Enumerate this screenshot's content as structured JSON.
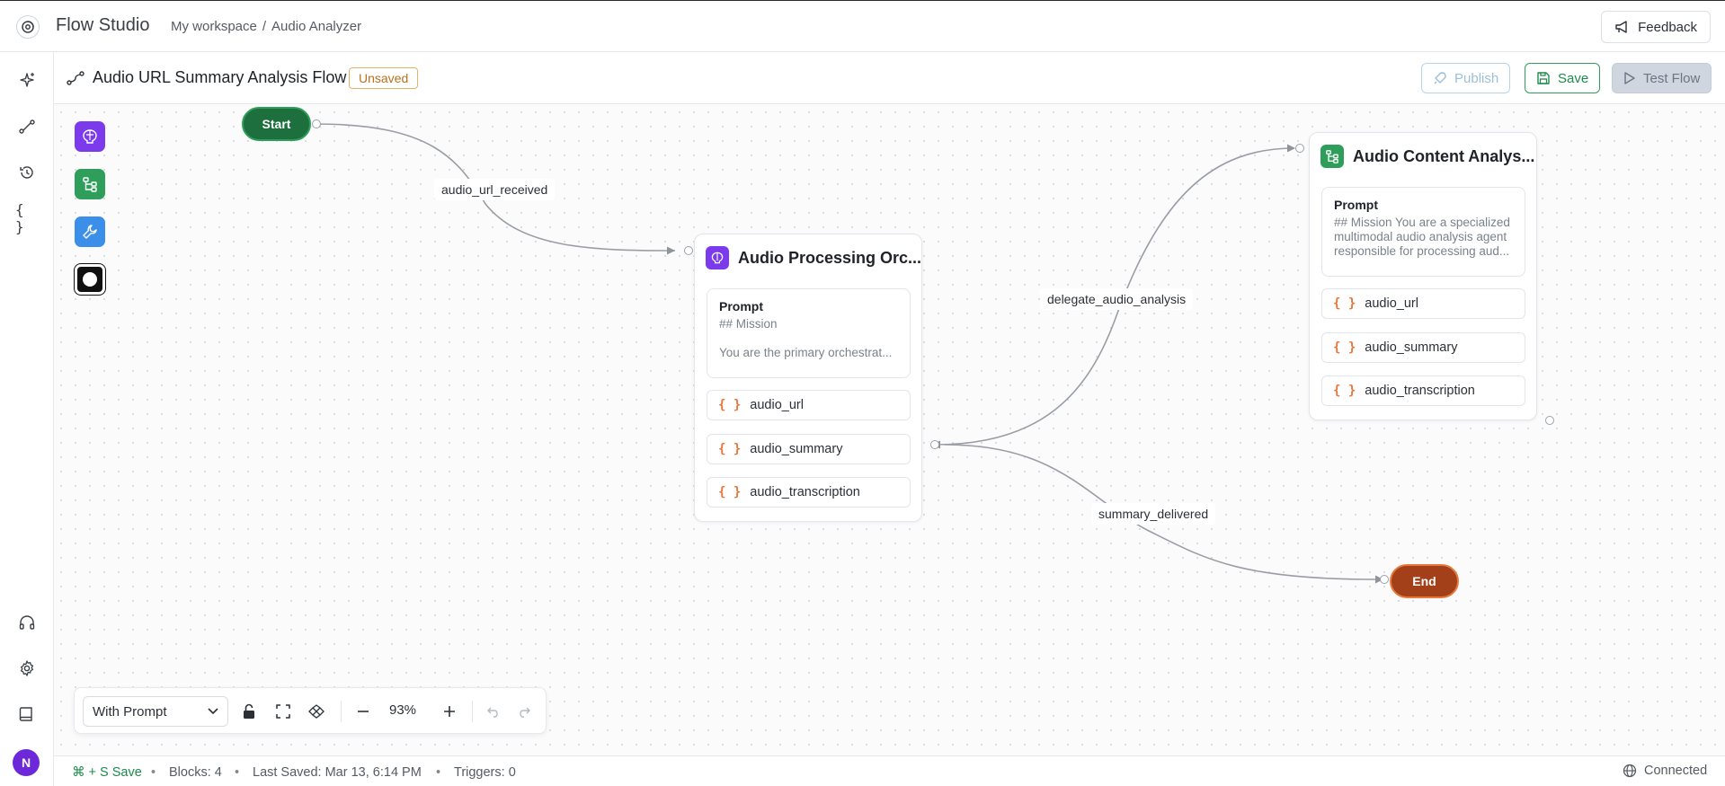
{
  "app": {
    "title": "Flow Studio",
    "breadcrumb": [
      "My workspace",
      "/",
      "Audio Analyzer"
    ],
    "feedback_label": "Feedback"
  },
  "flow": {
    "title": "Audio URL Summary Analysis Flow",
    "status_badge": "Unsaved",
    "actions": {
      "publish": "Publish",
      "save": "Save",
      "test": "Test Flow"
    }
  },
  "rail": {
    "avatar_initial": "N"
  },
  "canvas": {
    "start_label": "Start",
    "end_label": "End",
    "edges": {
      "e1": "audio_url_received",
      "e2": "delegate_audio_analysis",
      "e3": "summary_delivered"
    },
    "nodes": {
      "orchestrator": {
        "title": "Audio Processing Orc...",
        "prompt_title": "Prompt",
        "prompt_line1": "## Mission",
        "prompt_line2": "You are the primary orchestrat...",
        "vars": [
          "audio_url",
          "audio_summary",
          "audio_transcription"
        ]
      },
      "analyzer": {
        "title": "Audio Content Analys...",
        "prompt_title": "Prompt",
        "prompt_text": "## Mission You are a specialized multimodal audio analysis agent responsible for processing aud...",
        "vars": [
          "audio_url",
          "audio_summary",
          "audio_transcription"
        ]
      }
    },
    "palette": [
      "agent-block",
      "workflow-block",
      "tool-block",
      "end-block"
    ],
    "colors": {
      "start": "#1e6f3e",
      "end": "#a3401a",
      "agent": "#7c3aed",
      "workflow": "#2f9e5b",
      "tool": "#3b8fe8"
    }
  },
  "toolbar": {
    "mode_select": "With Prompt",
    "zoom": "93%"
  },
  "status": {
    "shortcut": "⌘ + S Save",
    "blocks": "Blocks: 4",
    "last_saved": "Last Saved: Mar 13, 6:14 PM",
    "triggers": "Triggers: 0",
    "connection": "Connected"
  }
}
